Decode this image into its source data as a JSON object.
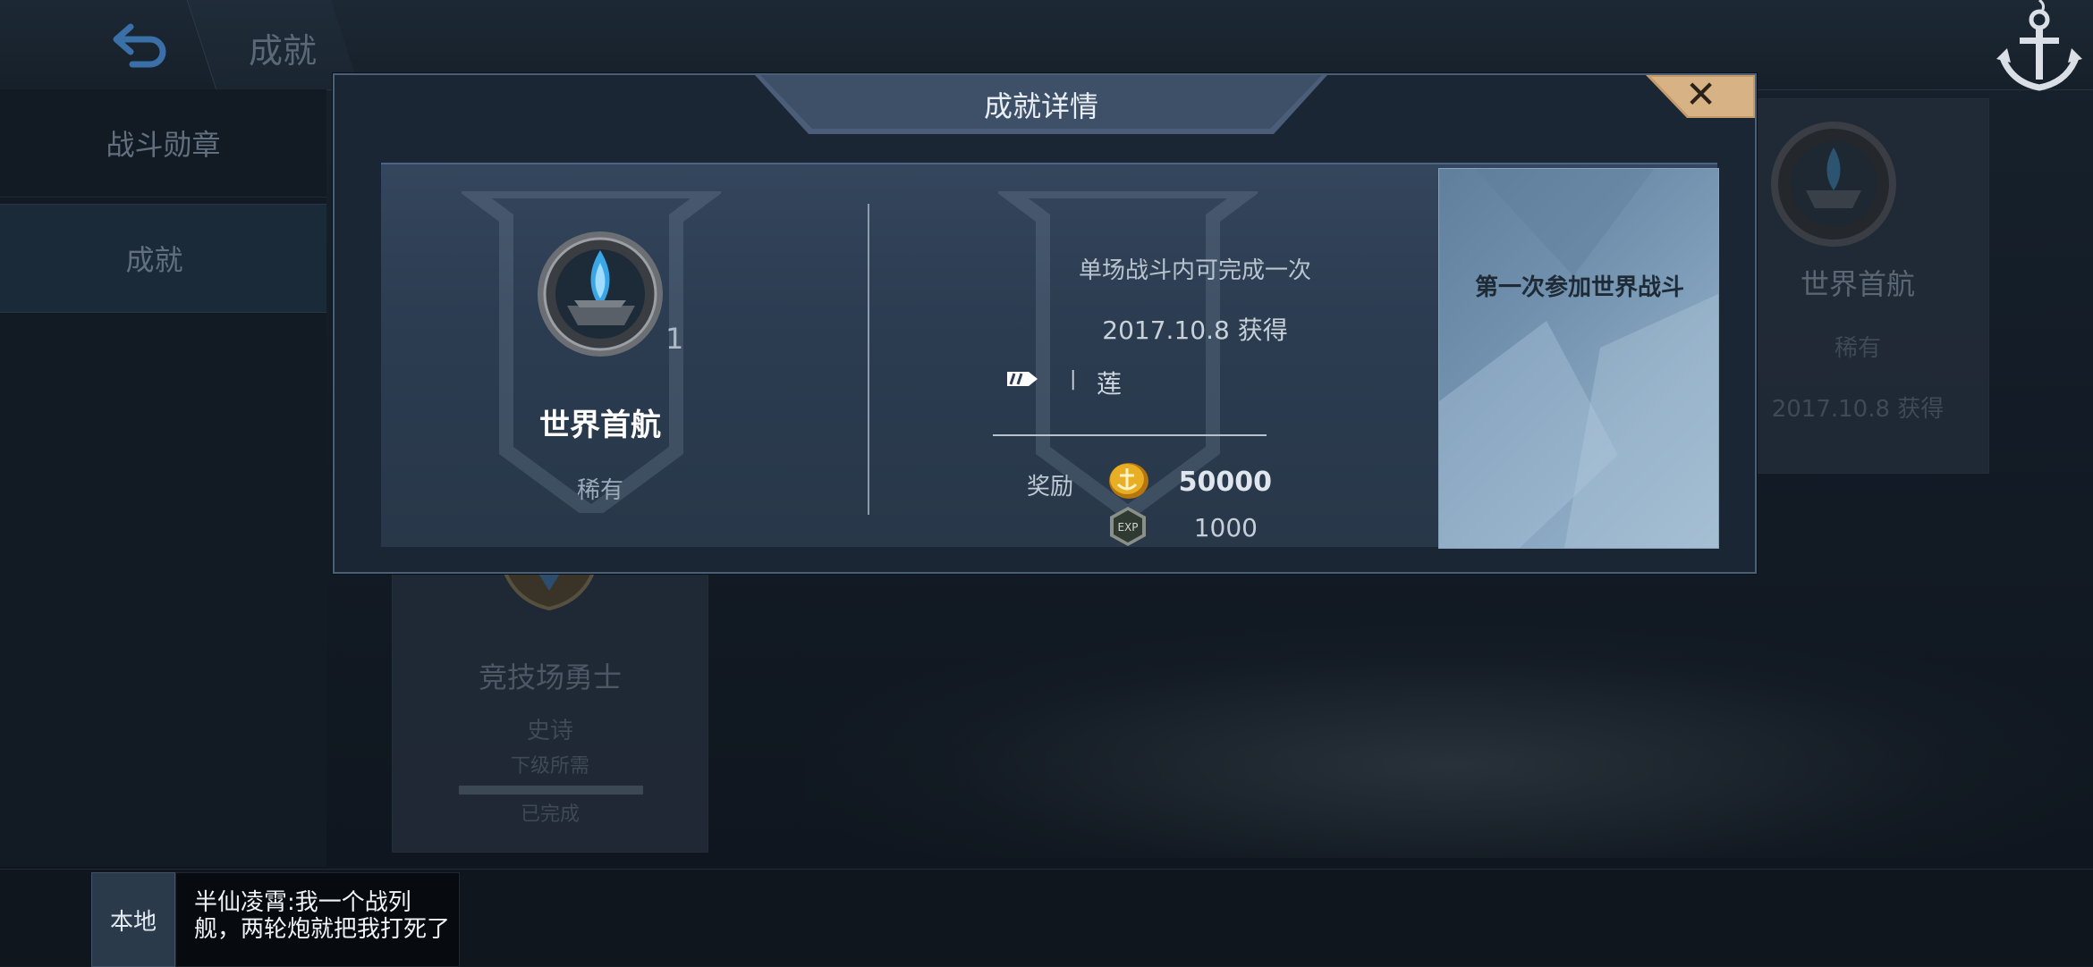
{
  "header": {
    "title": "成就"
  },
  "sidebar": {
    "items": [
      {
        "label": "战斗勋章"
      },
      {
        "label": "成就"
      }
    ]
  },
  "background_cards": [
    {
      "name": "竞技场勇士",
      "rarity": "史诗",
      "requirement_label": "下级所需",
      "status": "已完成"
    },
    {
      "name": "世界首航",
      "rarity": "稀有",
      "date": "2017.10.8 获得"
    }
  ],
  "dialog": {
    "title": "成就详情",
    "medal": {
      "name": "世界首航",
      "rarity": "稀有",
      "count": "1"
    },
    "condition": "单场战斗内可完成一次",
    "date": "2017.10.8 获得",
    "ship": {
      "separator": "|",
      "name": "莲"
    },
    "reward": {
      "label": "奖励",
      "coin": "50000",
      "exp": "1000"
    },
    "description": "第一次参加世界战斗"
  },
  "chat": {
    "channel": "本地",
    "message": "半仙凌霄:我一个战列舰，两轮炮就把我打死了"
  },
  "colors": {
    "accent": "#4b5f77",
    "coin": "#e0a21c",
    "close_button": "#c49a6a"
  }
}
